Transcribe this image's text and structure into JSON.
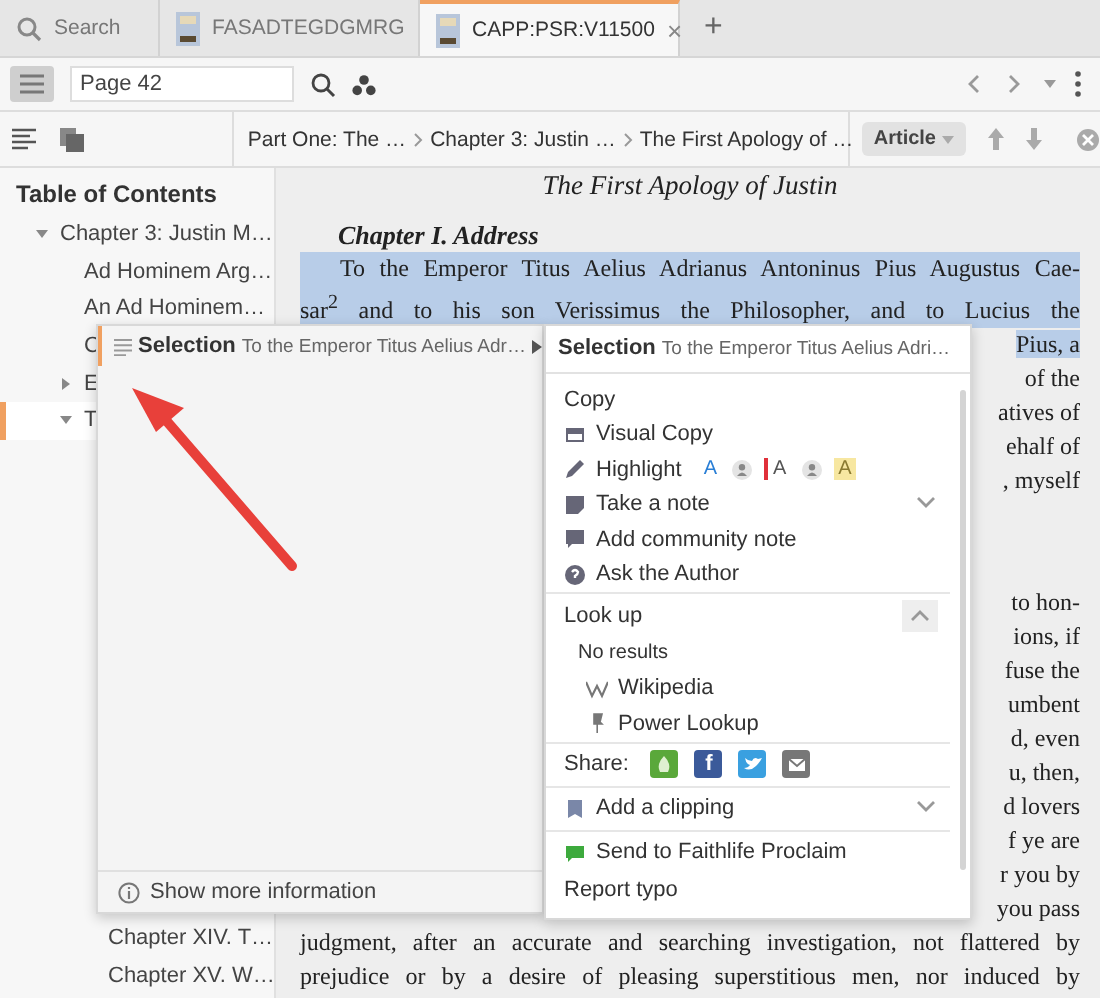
{
  "tabs": [
    {
      "kind": "search",
      "label": "Search",
      "selected": false
    },
    {
      "kind": "book",
      "label": "FASADTEGDGMRG",
      "selected": false
    },
    {
      "kind": "book",
      "label": "CAPP:PSR:V11500",
      "selected": true,
      "close": "×"
    }
  ],
  "new_tab": "+",
  "toolbar": {
    "page_field": {
      "value": "Page 42"
    }
  },
  "breadcrumbs": [
    "Part One: The …",
    "Chapter 3: Justin …",
    "The First Apology of …"
  ],
  "article_button": {
    "label": "Article"
  },
  "toc": {
    "title": "Table of Contents",
    "items": [
      {
        "label": "Chapter 3: Justin M…",
        "expanded": true,
        "selected": false,
        "children": [
          {
            "label": "Ad Hominem Arg…",
            "selected": false
          },
          {
            "label": "An Ad Hominem…",
            "selected": false
          },
          {
            "label": "C",
            "selected": false
          },
          {
            "label": "E",
            "expanded": false,
            "selected": false
          },
          {
            "label": "T",
            "expanded": true,
            "selected": true,
            "children": [
              {
                "label": "Chapter XIV. T…",
                "selected": false
              },
              {
                "label": "Chapter XV. W…",
                "selected": false
              }
            ]
          }
        ]
      }
    ]
  },
  "document": {
    "title": "The First Apology of Justin",
    "heading": "Chapter I. Address",
    "paragraphs": [
      [
        {
          "kind": "full",
          "text": "To the Emperor Titus Aelius Adrianus Antoninus Pius Augustus Cae-",
          "selected": true
        },
        {
          "kind": "full",
          "text": "sar$^{2}$ and to his son Verissimus the Philosopher, and to Lucius the",
          "selected": true
        },
        {
          "kind": "fragment",
          "text": "Pius, a",
          "selected": true
        },
        {
          "kind": "fragment",
          "text": "of the",
          "selected": false
        },
        {
          "kind": "fragment",
          "text": "atives of",
          "selected": false
        },
        {
          "kind": "fragment",
          "text": "ehalf of",
          "selected": false
        },
        {
          "kind": "fragment",
          "text": ", myself",
          "selected": false
        }
      ],
      [
        {
          "kind": "fragment",
          "text": "to hon-",
          "selected": false
        },
        {
          "kind": "fragment",
          "text": "ions, if",
          "selected": false
        },
        {
          "kind": "fragment",
          "text": "fuse the",
          "selected": false
        },
        {
          "kind": "fragment",
          "text": "umbent",
          "selected": false
        },
        {
          "kind": "fragment",
          "text": "d, even",
          "selected": false
        },
        {
          "kind": "fragment",
          "text": "u, then,",
          "selected": false
        },
        {
          "kind": "fragment",
          "text": "d lovers",
          "selected": false
        },
        {
          "kind": "fragment",
          "text": "f ye are",
          "selected": false
        },
        {
          "kind": "fragment",
          "text": "r you by",
          "selected": false
        },
        {
          "kind": "fragment",
          "text": "you pass",
          "selected": false
        },
        {
          "kind": "full",
          "text": "judgment, after an accurate and searching investigation, not flattered by",
          "selected": false
        },
        {
          "kind": "full",
          "text": "prejudice or by a desire of pleasing superstitious men, nor induced by",
          "selected": false
        }
      ]
    ]
  },
  "selection_panel": {
    "title": "Selection",
    "excerpt": "To the Emperor Titus Aelius Adr…",
    "footer": "Show more information"
  },
  "context_menu": {
    "title": "Selection",
    "excerpt": "To the Emperor Titus Aelius Adri…",
    "items": [
      {
        "kind": "plain",
        "label": "Copy"
      },
      {
        "kind": "screen",
        "label": "Visual Copy"
      },
      {
        "kind": "highlight",
        "label": "Highlight",
        "styles": [
          {
            "kind": "letter",
            "label": "A",
            "color": "#2a7fd6"
          },
          {
            "kind": "person"
          },
          {
            "kind": "bar",
            "label": "A",
            "color": "#e0303a"
          },
          {
            "kind": "person"
          },
          {
            "kind": "marker",
            "label": "A",
            "color": "#f7e7a1"
          }
        ]
      },
      {
        "kind": "note",
        "label": "Take a note",
        "expanded": false
      },
      {
        "kind": "comment",
        "label": "Add community note"
      },
      {
        "kind": "help",
        "label": "Ask the Author"
      },
      {
        "kind": "section",
        "label": "Look up",
        "expanded": true
      },
      {
        "kind": "info",
        "label": "No results"
      },
      {
        "kind": "wiki",
        "label": "Wikipedia"
      },
      {
        "kind": "pin",
        "label": "Power Lookup"
      },
      {
        "kind": "share",
        "label": "Share:",
        "buttons": [
          {
            "kind": "flame",
            "color": "#5aa83a"
          },
          {
            "kind": "letter",
            "label": "f",
            "color": "#3b5a9a"
          },
          {
            "kind": "bird",
            "color": "#3aa0e0"
          },
          {
            "kind": "envelope",
            "color": "#777777"
          }
        ]
      },
      {
        "kind": "clip",
        "label": "Add a clipping",
        "expanded": false
      },
      {
        "kind": "proclaim",
        "label": "Send to Faithlife Proclaim"
      },
      {
        "kind": "plain",
        "label": "Report typo"
      }
    ]
  }
}
